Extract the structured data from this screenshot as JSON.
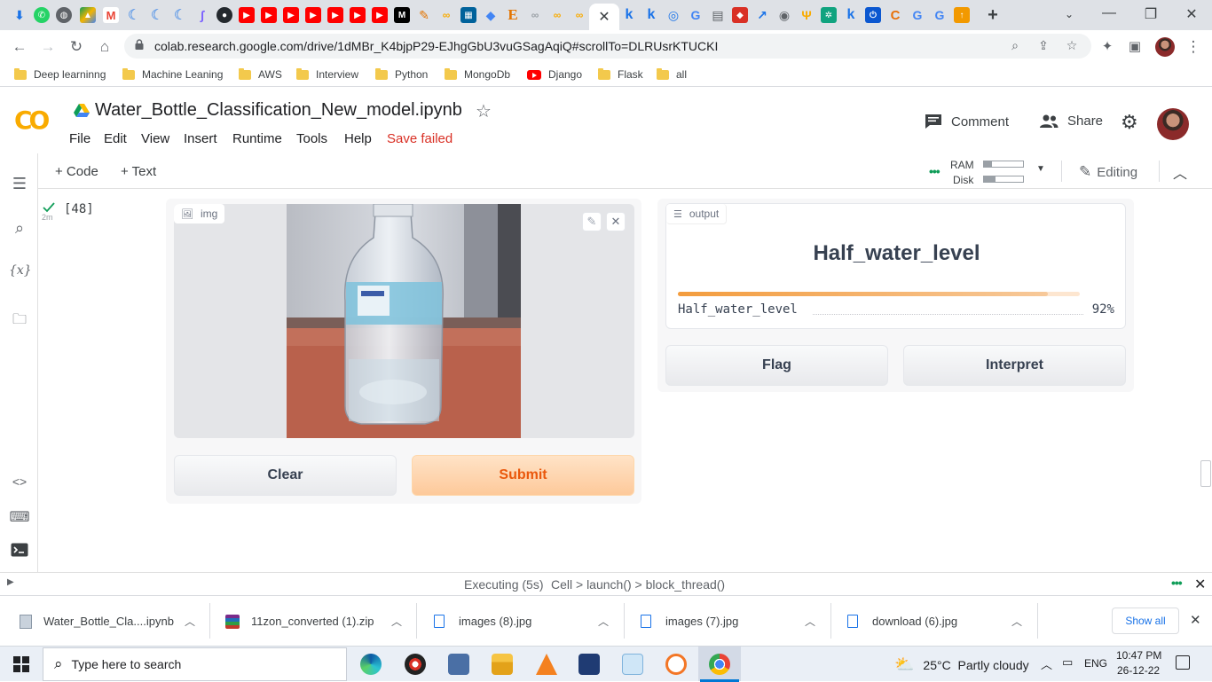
{
  "browser": {
    "active_tab_close": "✕",
    "new_tab": "+",
    "url": "colab.research.google.com/drive/1dMBr_K4bjpP29-EJhgGbU3vuGSagAqiQ#scrollTo=DLRUsrKTUCKI",
    "bookmarks": [
      {
        "label": "Deep learninng",
        "icon": "folder"
      },
      {
        "label": "Machine Leaning",
        "icon": "folder"
      },
      {
        "label": "AWS",
        "icon": "folder"
      },
      {
        "label": "Interview",
        "icon": "folder"
      },
      {
        "label": "Python",
        "icon": "folder"
      },
      {
        "label": "MongoDb",
        "icon": "folder"
      },
      {
        "label": "Django",
        "icon": "youtube"
      },
      {
        "label": "Flask",
        "icon": "folder"
      },
      {
        "label": "all",
        "icon": "folder"
      }
    ]
  },
  "colab": {
    "logo": "CO",
    "title": "Water_Bottle_Classification_New_model.ipynb",
    "menu": [
      "File",
      "Edit",
      "View",
      "Insert",
      "Runtime",
      "Tools",
      "Help"
    ],
    "save_status": "Save failed",
    "comment": "Comment",
    "share": "Share",
    "add_code": "+ Code",
    "add_text": "+ Text",
    "ram_label": "RAM",
    "disk_label": "Disk",
    "ram_usage": 0.2,
    "disk_usage": 0.3,
    "editing": "Editing"
  },
  "cell": {
    "exec_count": "[48]",
    "elapsed": "2m"
  },
  "gradio": {
    "input_label": "img",
    "clear_button": "Clear",
    "submit_button": "Submit",
    "output_label": "output",
    "prediction": "Half_water_level",
    "confidences": [
      {
        "label": "Half_water_level",
        "value": "92%",
        "fraction": 0.92
      }
    ],
    "flag_button": "Flag",
    "interpret_button": "Interpret"
  },
  "status": {
    "executing": "Executing (5s)",
    "trace": "Cell > launch() > block_thread()"
  },
  "downloads": {
    "items": [
      "Water_Bottle_Cla....ipynb",
      "11zon_converted (1).zip",
      "images (8).jpg",
      "images (7).jpg",
      "download (6).jpg"
    ],
    "show_all": "Show all"
  },
  "taskbar": {
    "search_placeholder": "Type here to search",
    "weather": "25°C  Partly cloudy",
    "language": "ENG",
    "time": "10:47 PM",
    "date": "26-12-22"
  }
}
